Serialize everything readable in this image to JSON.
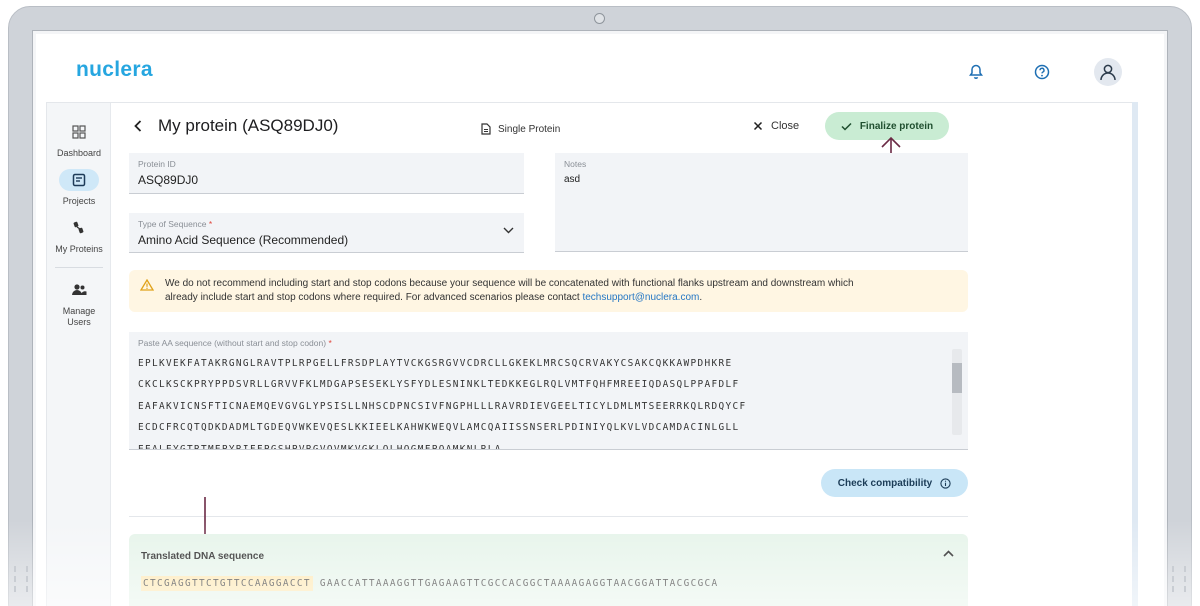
{
  "app": {
    "logo": "nuclera"
  },
  "sidebar": {
    "items": [
      {
        "label": "Dashboard",
        "icon": "grid-icon"
      },
      {
        "label": "Projects",
        "icon": "projects-icon",
        "active": true
      },
      {
        "label": "My Proteins",
        "icon": "proteins-icon"
      },
      {
        "label": "Manage Users",
        "icon": "users-icon"
      }
    ]
  },
  "page": {
    "title": "My protein (ASQ89DJ0)",
    "mode": "Single Protein",
    "close_label": "Close",
    "finalize_label": "Finalize protein"
  },
  "form": {
    "protein_id": {
      "label": "Protein ID",
      "value": "ASQ89DJ0"
    },
    "sequence_type": {
      "label": "Type of Sequence",
      "required": "*",
      "value": "Amino Acid Sequence (Recommended)"
    },
    "notes": {
      "label": "Notes",
      "value": "asd"
    },
    "warning": {
      "text_1": "We do not recommend including start and stop codons because your sequence will be concatenated with functional flanks upstream and downstream which",
      "text_2": "already include start and stop codons where required. For advanced scenarios please contact ",
      "link": "techsupport@nuclera.com",
      "tail": "."
    },
    "aa_sequence": {
      "label": "Paste AA sequence (without start and stop codon)",
      "required": "*",
      "lines": [
        "EPLKVEKFATAKRGNGLRAVTPLRPGELLFRSDPLAYTVCKGSRGVVCDRCLLGKEKLMRCSQCRVAKYCSAKCQKKAWPDHKRE",
        "CKCLKSCKPRYPPDSVRLLGRVVFKLMDGAPSESEKLYSFYDLESNINKLTEDKKEGLRQLVMTFQHFMREEIQDASQLPPAFDLF",
        "EAFAKVICNSFTICNAEMQEVGVGLYPSISLLNHSCDPNCSIVFNGPHLLLRAVRDIEVGEELTICYLDMLMTSEERRKQLRDQYCF",
        "ECDCFRCQTQDKDADMLTGDEQVWKEVQESLKKIEELKAHWKWEQVLAMCQAIISSNSERLPDINIYQLKVLVDCAMDACINLGLL",
        "EEALEYGTRTMEPYRIFFPGSHPVRGVQVMKVGKLQLHQGMFPQAMKNLRLA"
      ]
    },
    "check_label": "Check compatibility"
  },
  "dna": {
    "title": "Translated DNA sequence",
    "highlight": "CTCGAGGTTCTGTTCCAAGGACCT",
    "rest": "GAACCATTAAAGGTTGAGAAGTTCGCCACGGCTAAAAGAGGTAACGGATTACGCGCA"
  },
  "colors": {
    "brand": "#26a6e0",
    "finalize_bg": "#c9ecd3",
    "check_bg": "#c9e6f7",
    "warning_bg": "#fff6e3",
    "dna_bg": "#e6f4ea",
    "highlight": "#fde8b2",
    "annotation_arrow": "#6b2a45"
  }
}
